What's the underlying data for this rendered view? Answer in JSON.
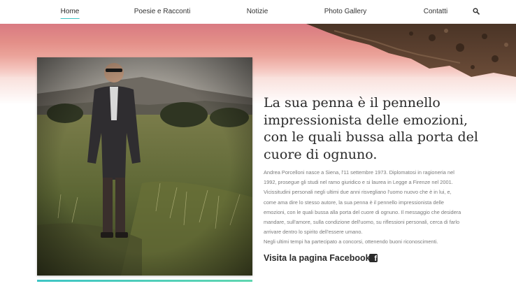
{
  "nav": {
    "items": [
      {
        "label": "Home",
        "active": true
      },
      {
        "label": "Poesie e Racconti"
      },
      {
        "label": "Notizie"
      },
      {
        "label": "Photo Gallery"
      },
      {
        "label": "Contatti"
      }
    ],
    "search_icon": "search-icon",
    "accent_color": "#3ec5c5"
  },
  "hero": {
    "colors": [
      "#d97a82",
      "#eba39a",
      "#f8dcd7"
    ]
  },
  "intro": {
    "headline_lines": [
      "La sua penna è il pennello",
      "impressionista delle emozioni,",
      "con le quali bussa alla porta del",
      "cuore di ognuno."
    ],
    "bio_lines": [
      "Andrea Porcelloni nasce a Siena, l'11 settembre 1973. Diplomatosi in ragioneria nel",
      "1992, prosegue gli studi nel ramo giuridico e si laurea in Legge a Firenze nel 2001.",
      "Vicissitudini personali negli ultimi due anni risvegliano l'uomo nuovo che è in lui, e,",
      "come ama dire lo stesso autore, la sua penna è il pennello impressionista delle",
      "emozioni, con le quali bussa alla porta del cuore di ognuno. Il messaggio che desidera",
      "mandare, sull'amore, sulla condizione dell'uomo, su riflessioni personali, cerca di farlo",
      "arrivare dentro lo spirito dell'essere umano.",
      "Negli ultimi tempi ha partecipato a concorsi, ottenendo buoni riconoscimenti."
    ],
    "facebook_label": "Visita la pagina Facebook",
    "facebook_icon": "facebook-icon",
    "facebook_glyph": "f"
  }
}
